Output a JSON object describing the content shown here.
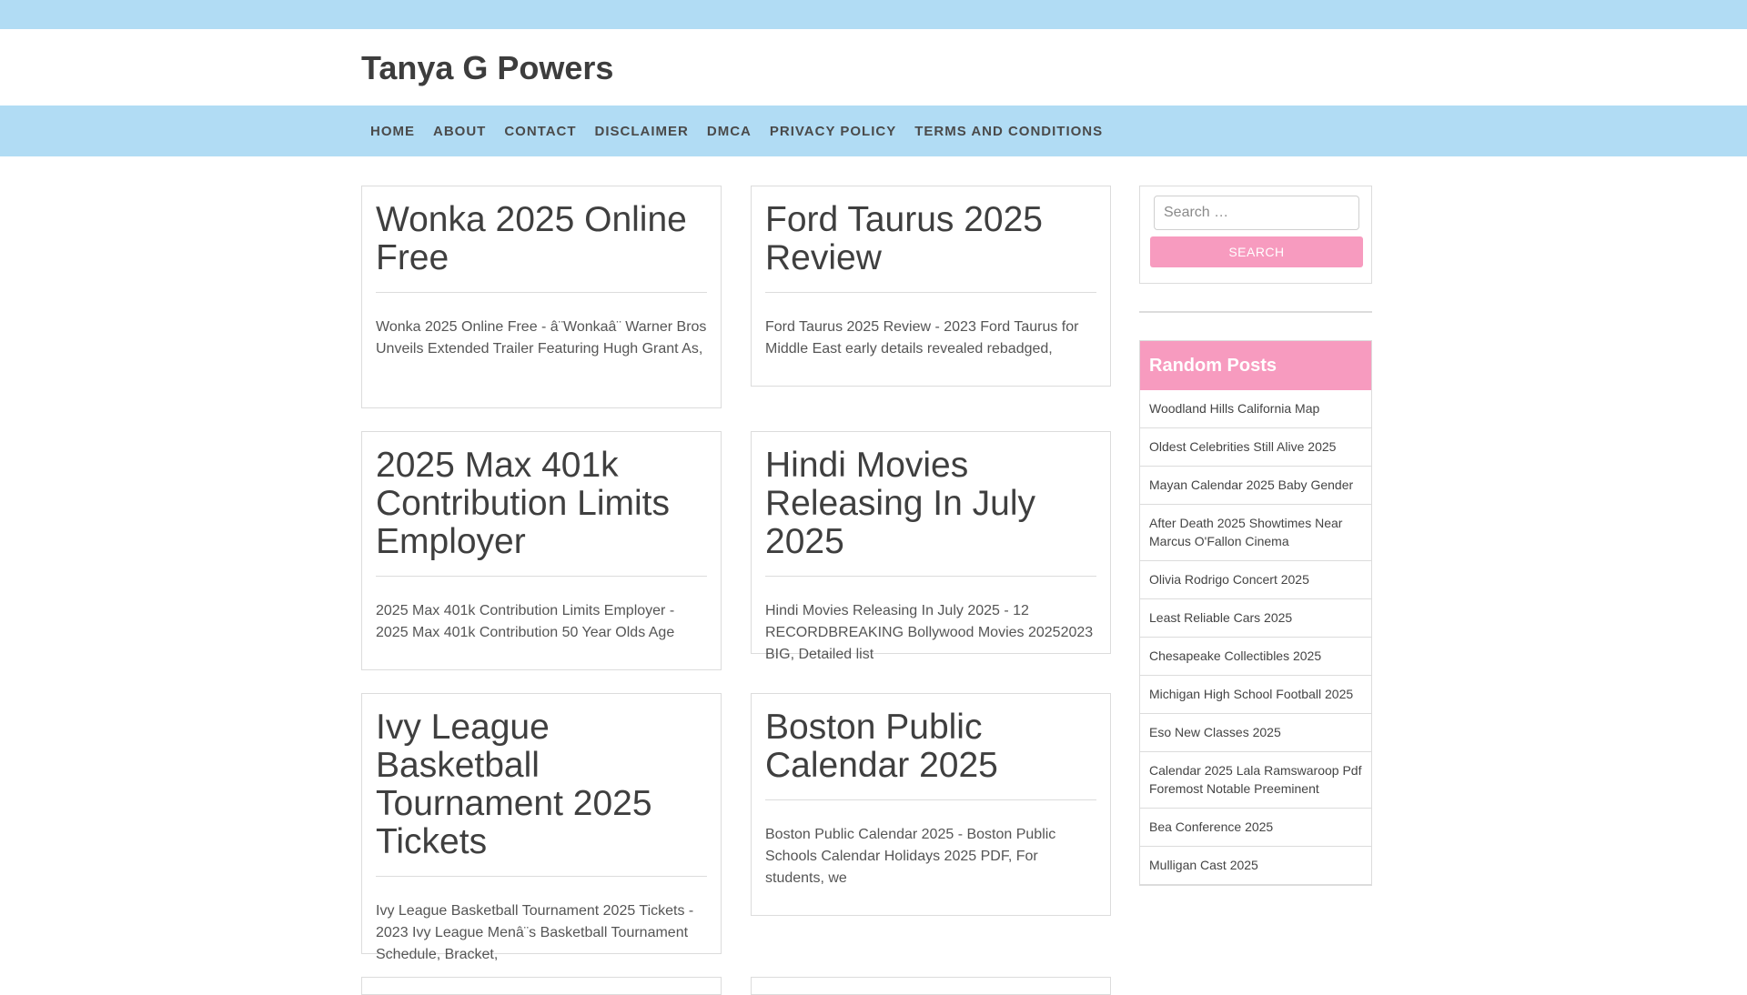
{
  "site": {
    "title": "Tanya G Powers"
  },
  "nav": [
    "HOME",
    "ABOUT",
    "CONTACT",
    "DISCLAIMER",
    "DMCA",
    "PRIVACY POLICY",
    "TERMS AND CONDITIONS"
  ],
  "posts": [
    {
      "title": "Wonka 2025 Online Free",
      "excerpt": "Wonka 2025 Online Free - â¨Wonkaâ¨ Warner Bros Unveils Extended Trailer Featuring Hugh Grant As,"
    },
    {
      "title": "Ford Taurus 2025 Review",
      "excerpt": "Ford Taurus 2025 Review - 2023 Ford Taurus for Middle East early details revealed rebadged,"
    },
    {
      "title": "2025 Max 401k Contribution Limits Employer",
      "excerpt": "2025 Max 401k Contribution Limits Employer - 2025 Max 401k Contribution 50 Year Olds Age"
    },
    {
      "title": "Hindi Movies Releasing In July 2025",
      "excerpt": "Hindi Movies Releasing In July 2025 - 12 RECORDBREAKING Bollywood Movies 20252023 BIG, Detailed list"
    },
    {
      "title": "Ivy League Basketball Tournament 2025 Tickets",
      "excerpt": "Ivy League Basketball Tournament 2025 Tickets - 2023 Ivy League Menâ¨s Basketball Tournament Schedule, Bracket,"
    },
    {
      "title": "Boston Public Calendar 2025",
      "excerpt": "Boston Public Calendar 2025 - Boston Public Schools Calendar Holidays 2025 PDF, For students, we"
    }
  ],
  "search": {
    "placeholder": "Search …",
    "button_label": "Search"
  },
  "random_posts": {
    "heading": "Random Posts",
    "items": [
      "Woodland Hills California Map",
      "Oldest Celebrities Still Alive 2025",
      "Mayan Calendar 2025 Baby Gender",
      "After Death 2025 Showtimes Near Marcus O'Fallon Cinema",
      "Olivia Rodrigo Concert 2025",
      "Least Reliable Cars 2025",
      "Chesapeake Collectibles 2025",
      "Michigan High School Football 2025",
      "Eso New Classes 2025",
      "Calendar 2025 Lala Ramswaroop Pdf Foremost Notable Preeminent",
      "Bea Conference 2025",
      "Mulligan Cast 2025"
    ]
  },
  "colors": {
    "topbar": "#b1dcf4",
    "accent_pink": "#f79bbf",
    "border": "#dcdcdc"
  }
}
